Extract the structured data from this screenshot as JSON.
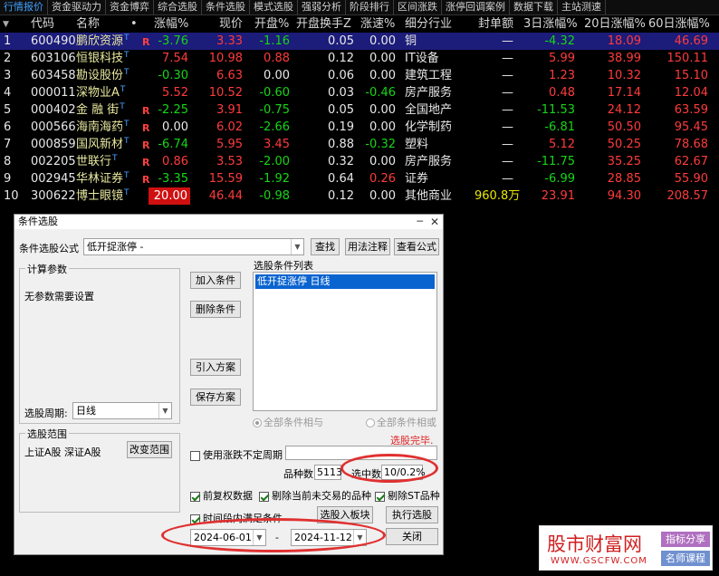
{
  "menubar": {
    "tabs": [
      "行情报价",
      "资金驱动力",
      "资金博弈",
      "综合选股",
      "条件选股",
      "模式选股",
      "强弱分析",
      "阶段排行",
      "区间涨跌",
      "涨停回调案例",
      "数据下载",
      "主站测速"
    ]
  },
  "table": {
    "headers": {
      "code": "代码",
      "name": "名称",
      "dot": "•",
      "chg": "涨幅%",
      "price": "现价",
      "open": "开盘%",
      "turnover": "开盘换手Z",
      "speed": "涨速%",
      "industry": "细分行业",
      "seal": "封单额",
      "d3": "3日涨幅%",
      "d20": "20日涨幅%",
      "d60": "60日涨幅%"
    },
    "rows": [
      {
        "idx": "1",
        "code": "600490",
        "name": "鹏欣资源",
        "sup": "T",
        "flag": "R",
        "chg": "-3.76",
        "price": "3.33",
        "open": "-1.16",
        "turnover": "0.05",
        "speed": "0.00",
        "industry": "铜",
        "seal": "—",
        "d3": "-4.32",
        "d20": "18.09",
        "d60": "46.69"
      },
      {
        "idx": "2",
        "code": "603106",
        "name": "恒银科技",
        "sup": "T",
        "flag": "",
        "chg": "7.54",
        "price": "10.98",
        "open": "0.88",
        "turnover": "0.12",
        "speed": "0.00",
        "industry": "IT设备",
        "seal": "—",
        "d3": "5.99",
        "d20": "38.99",
        "d60": "150.11"
      },
      {
        "idx": "3",
        "code": "603458",
        "name": "勘设股份",
        "sup": "T",
        "flag": "",
        "chg": "-0.30",
        "price": "6.63",
        "open": "0.00",
        "turnover": "0.06",
        "speed": "0.00",
        "industry": "建筑工程",
        "seal": "—",
        "d3": "1.23",
        "d20": "10.32",
        "d60": "15.10"
      },
      {
        "idx": "4",
        "code": "000011",
        "name": "深物业A",
        "sup": "T",
        "flag": "",
        "chg": "5.52",
        "price": "10.52",
        "open": "-0.60",
        "turnover": "0.03",
        "speed": "-0.46",
        "industry": "房产服务",
        "seal": "—",
        "d3": "0.48",
        "d20": "17.14",
        "d60": "12.04"
      },
      {
        "idx": "5",
        "code": "000402",
        "name": "金 融 街",
        "sup": "T",
        "flag": "R",
        "chg": "-2.25",
        "price": "3.91",
        "open": "-0.75",
        "turnover": "0.05",
        "speed": "0.00",
        "industry": "全国地产",
        "seal": "—",
        "d3": "-11.53",
        "d20": "24.12",
        "d60": "63.59"
      },
      {
        "idx": "6",
        "code": "000566",
        "name": "海南海药",
        "sup": "T",
        "flag": "R",
        "chg": "0.00",
        "price": "6.02",
        "open": "-2.66",
        "turnover": "0.19",
        "speed": "0.00",
        "industry": "化学制药",
        "seal": "—",
        "d3": "-6.81",
        "d20": "50.50",
        "d60": "95.45"
      },
      {
        "idx": "7",
        "code": "000859",
        "name": "国风新材",
        "sup": "T",
        "flag": "R",
        "chg": "-6.74",
        "price": "5.95",
        "open": "3.45",
        "turnover": "0.88",
        "speed": "-0.32",
        "industry": "塑料",
        "seal": "—",
        "d3": "5.12",
        "d20": "50.25",
        "d60": "78.68"
      },
      {
        "idx": "8",
        "code": "002205",
        "name": "世联行",
        "sup": "T",
        "flag": "R",
        "chg": "0.86",
        "price": "3.53",
        "open": "-2.00",
        "turnover": "0.32",
        "speed": "0.00",
        "industry": "房产服务",
        "seal": "—",
        "d3": "-11.75",
        "d20": "35.25",
        "d60": "62.67"
      },
      {
        "idx": "9",
        "code": "002945",
        "name": "华林证券",
        "sup": "T",
        "flag": "R",
        "chg": "-3.35",
        "price": "15.59",
        "open": "-1.92",
        "turnover": "0.64",
        "speed": "0.26",
        "industry": "证券",
        "seal": "—",
        "d3": "-6.99",
        "d20": "28.85",
        "d60": "55.90"
      },
      {
        "idx": "10",
        "code": "300622",
        "name": "博士眼镜",
        "sup": "T",
        "flag": "",
        "chg": "20.00",
        "price": "46.44",
        "open": "-0.98",
        "turnover": "0.12",
        "speed": "0.00",
        "industry": "其他商业",
        "seal": "960.8万",
        "d3": "23.91",
        "d20": "94.30",
        "d60": "208.57"
      }
    ]
  },
  "dialog": {
    "title": "条件选股",
    "close": "✕",
    "minimize": "─",
    "formula_label": "条件选股公式",
    "formula_value": "低开捉涨停  -",
    "find_btn": "查找",
    "usage_btn": "用法注释",
    "view_btn": "查看公式",
    "params_group": "计算参数",
    "params_text": "无参数需要设置",
    "add_btn": "加入条件",
    "delete_btn": "删除条件",
    "import_btn": "引入方案",
    "save_btn": "保存方案",
    "list_group": "选股条件列表",
    "list_items": [
      "低开捉涨停  日线"
    ],
    "period_label": "选股周期:",
    "period_value": "日线",
    "radio_and": "全部条件相与",
    "radio_or": "全部条件相或",
    "finish_text": "选股完毕.",
    "range_group": "选股范围",
    "range_text": "上证A股 深证A股",
    "change_range_btn": "改变范围",
    "indef_label": "使用涨跌不定周期",
    "count_label": "品种数",
    "count_value": "5113",
    "selected_label": "选中数",
    "selected_value": "10/0.2%",
    "chk_prefq": "前复权数据",
    "chk_exclude_notrade": "剔除当前未交易的品种",
    "chk_exclude_st": "剔除ST品种",
    "chk_period": "时间段内满足条件",
    "add_block_btn": "选股入板块",
    "run_btn": "执行选股",
    "close_btn": "关闭",
    "date_start": "2024-06-01",
    "date_sep": "-",
    "date_end": "2024-11-12"
  },
  "watermark": {
    "title": "股市财富网",
    "url": "WWW.GSCFW.COM",
    "tag1": "指标分享",
    "tag2": "名师课程"
  },
  "colors": {
    "up": "#ff3b3b",
    "down": "#16d616",
    "highlight": "#e03030"
  }
}
